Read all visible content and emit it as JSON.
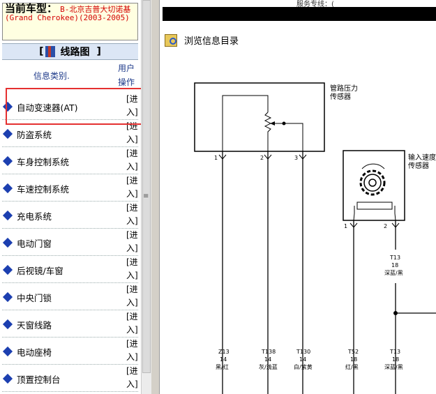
{
  "service_hotline_fragment": "服务专线：(",
  "left": {
    "vehicle_label": "当前车型：",
    "vehicle_value": "B-北京吉普大切诺基(Grand Cherokee)(2003-2005)",
    "section_prefix": "[",
    "section_title": "线路图",
    "section_suffix": "]",
    "col_category": "信息类别.",
    "col_action": "用户操作",
    "items": [
      {
        "label": "自动变速器(AT)",
        "action": "[进入]"
      },
      {
        "label": "防盗系统",
        "action": "[进入]"
      },
      {
        "label": "车身控制系统",
        "action": "[进入]"
      },
      {
        "label": "车速控制系统",
        "action": "[进入]"
      },
      {
        "label": "充电系统",
        "action": "[进入]"
      },
      {
        "label": "电动门窗",
        "action": "[进入]"
      },
      {
        "label": "后视镜/车窗",
        "action": "[进入]"
      },
      {
        "label": "中央门锁",
        "action": "[进入]"
      },
      {
        "label": "天窗线路",
        "action": "[进入]"
      },
      {
        "label": "电动座椅",
        "action": "[进入]"
      },
      {
        "label": "顶置控制台",
        "action": "[进入]"
      }
    ]
  },
  "right": {
    "directory_title": "浏览信息目录",
    "diagram": {
      "sensor1_name": [
        "管路压力",
        "传感器"
      ],
      "sensor2_name": [
        "输入速度",
        "传感器"
      ],
      "pins1": [
        "1",
        "2",
        "3"
      ],
      "pins2": [
        "1",
        "2"
      ],
      "wire_mid_code": "T13",
      "wire_mid_gauge": "18",
      "wire_mid_color": "深蓝/黑",
      "wires_bottom": [
        {
          "code": "Z13",
          "gauge": "14",
          "color": "黑/红"
        },
        {
          "code": "T138",
          "gauge": "14",
          "color": "灰/浅蓝"
        },
        {
          "code": "T130",
          "gauge": "14",
          "color": "白/紫黄"
        },
        {
          "code": "T52",
          "gauge": "18",
          "color": "红/黑"
        },
        {
          "code": "T13",
          "gauge": "18",
          "color": "深蓝/黑"
        }
      ]
    }
  }
}
